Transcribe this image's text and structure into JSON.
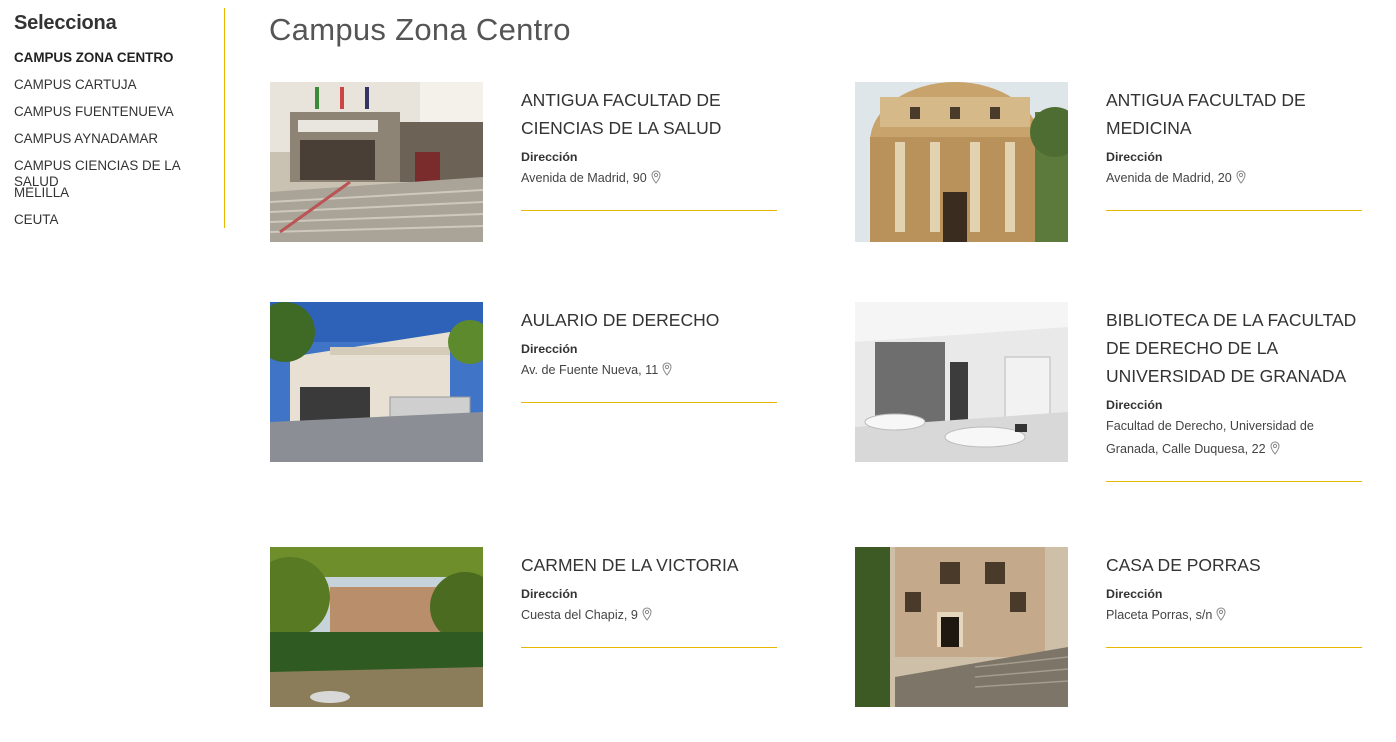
{
  "sidebar": {
    "title": "Selecciona",
    "items": [
      {
        "label": "CAMPUS ZONA CENTRO",
        "active": true
      },
      {
        "label": "CAMPUS CARTUJA"
      },
      {
        "label": "CAMPUS FUENTENUEVA"
      },
      {
        "label": "CAMPUS AYNADAMAR"
      },
      {
        "label": "CAMPUS CIENCIAS DE LA SALUD"
      },
      {
        "label": "MELILLA"
      },
      {
        "label": "CEUTA"
      }
    ]
  },
  "page": {
    "title": "Campus Zona Centro"
  },
  "buildings": [
    {
      "name": "ANTIGUA FACULTAD DE CIENCIAS DE LA SALUD",
      "address_label": "Dirección",
      "address": "Avenida de Madrid, 90"
    },
    {
      "name": "ANTIGUA FACULTAD DE MEDICINA",
      "address_label": "Dirección",
      "address": "Avenida de Madrid, 20"
    },
    {
      "name": "AULARIO DE DERECHO",
      "address_label": "Dirección",
      "address": "Av. de Fuente Nueva, 11"
    },
    {
      "name": "BIBLIOTECA DE LA FACULTAD DE DERECHO DE LA UNIVERSIDAD DE GRANADA",
      "address_label": "Dirección",
      "address": "Facultad de Derecho, Universidad de Granada, Calle Duquesa, 22"
    },
    {
      "name": "CARMEN DE LA VICTORIA",
      "address_label": "Dirección",
      "address": "Cuesta del Chapiz, 9"
    },
    {
      "name": "CASA DE PORRAS",
      "address_label": "Dirección",
      "address": "Placeta Porras, s/n"
    }
  ],
  "colors": {
    "accent": "#e6b800",
    "text": "#333333"
  },
  "icons": {
    "location": "map-pin-icon"
  }
}
